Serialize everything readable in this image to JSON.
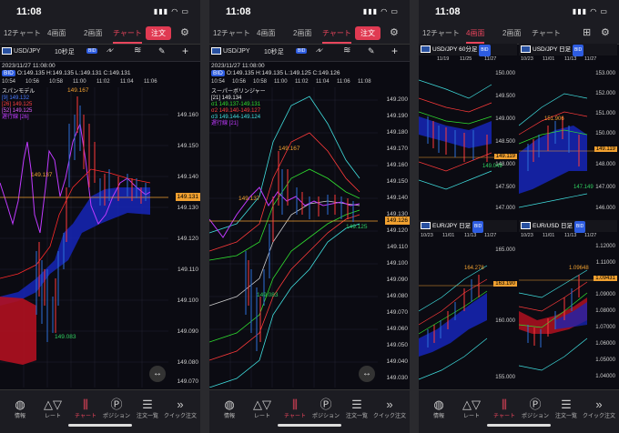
{
  "status": {
    "time": "11:08",
    "indicators": "▮▮▮ ◠ ▭"
  },
  "tabs": [
    "12チャート",
    "4画面",
    "2画面",
    "チャート"
  ],
  "order_label": "注文",
  "pair": "USD/JPY",
  "bid": "BID",
  "colors": {
    "accent": "#e8455c",
    "price_line": "#f0a030",
    "bid": "#2d5ce0"
  },
  "phone1": {
    "interval": "10秒足",
    "datetime": "2023/11/27 11:08:00",
    "ohlc": "O:149.135 H:149.135 L:149.131 C:149.131",
    "times": [
      "10:54",
      "10:56",
      "10:58",
      "11:00",
      "11:02",
      "11:04",
      "11:06"
    ],
    "axis": [
      "149.160",
      "149.150",
      "149.140",
      "149.130",
      "149.120",
      "149.110",
      "149.100",
      "149.090",
      "149.080",
      "149.070"
    ],
    "price": "149.131",
    "legend_title": "スパンモデル",
    "legend": [
      "[9] 149.132",
      "[26] 149.125",
      "[52] 149.125",
      "遅行線 [26]"
    ],
    "ann_high": "149.167",
    "ann_mid": "149.137",
    "ann_low": "149.083"
  },
  "phone2": {
    "interval": "10秒足",
    "datetime": "2023/11/27 11:08:00",
    "ohlc": "O:149.135 H:149.135 L:149.125 C:149.126",
    "times": [
      "10:54",
      "10:56",
      "10:58",
      "11:00",
      "11:02",
      "11:04",
      "11:06",
      "11:08"
    ],
    "axis": [
      "149.200",
      "149.190",
      "149.180",
      "149.170",
      "149.160",
      "149.150",
      "149.140",
      "149.130",
      "149.120",
      "149.110",
      "149.100",
      "149.090",
      "149.080",
      "149.070",
      "149.060",
      "149.050",
      "149.040",
      "149.030"
    ],
    "price": "149.126",
    "legend_title": "スーパーボリンジャー",
    "legend": [
      "[21] 149.134",
      "σ1 149.137-149.131",
      "σ2 149.140-149.127",
      "σ3 149.144-149.124",
      "遅行線 [21]"
    ],
    "ann_high": "149.167",
    "ann_mid": "149.137",
    "ann_low": "149.083",
    "ann_right": "149.125"
  },
  "phone3": {
    "charts": [
      {
        "title": "USD/JPY 60分足",
        "times": [
          "11/19",
          "11/25",
          "11/27"
        ],
        "axis": [
          "150.000",
          "149.500",
          "149.000",
          "148.500",
          "148.000",
          "147.500",
          "147.000"
        ],
        "price": "149.119",
        "ann_low": "149.049"
      },
      {
        "title": "USD/JPY 日足",
        "times": [
          "10/23",
          "11/01",
          "11/13",
          "11/27"
        ],
        "axis": [
          "153.000",
          "152.000",
          "151.000",
          "150.000",
          "149.000",
          "148.000",
          "147.000",
          "146.000"
        ],
        "price": "149.119",
        "ann_high": "151.906",
        "ann_low": "147.149"
      },
      {
        "title": "EUR/JPY 日足",
        "times": [
          "10/23",
          "11/01",
          "11/13",
          "11/27"
        ],
        "axis": [
          "165.000",
          "163.190",
          "160.000",
          "155.000"
        ],
        "price": "163.190",
        "ann_high": "164.278"
      },
      {
        "title": "EUR/USD 日足",
        "times": [
          "10/23",
          "11/01",
          "11/13",
          "11/27"
        ],
        "axis": [
          "1.12000",
          "1.11000",
          "1.10000",
          "1.09000",
          "1.08000",
          "1.07000",
          "1.06000",
          "1.05000",
          "1.04000"
        ],
        "price": "1.09431",
        "ann_high": "1.09648"
      }
    ]
  },
  "bottom_nav": [
    "情報",
    "レート",
    "チャート",
    "ポジション",
    "注文一覧",
    "クイック注文"
  ]
}
